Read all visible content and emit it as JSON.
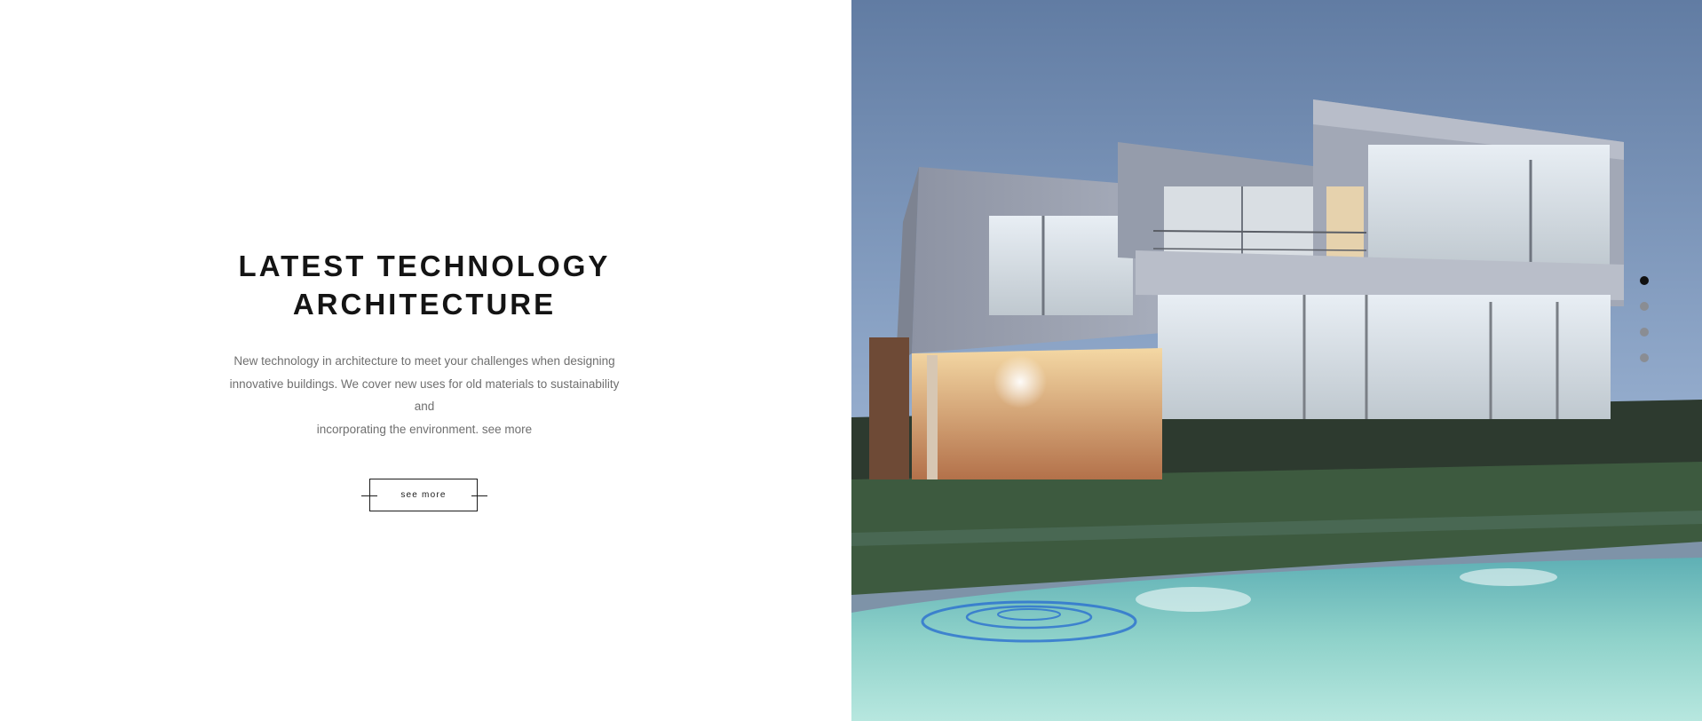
{
  "hero": {
    "headline_line1": "LATEST TECHNOLOGY",
    "headline_line2": "ARCHITECTURE",
    "description_line1": "New technology in architecture to meet your challenges when designing",
    "description_line2": "innovative buildings. We cover new uses for old materials to sustainability and",
    "description_line3": "incorporating the environment. see more",
    "cta_label": "see more"
  },
  "slider": {
    "slide_count": 4,
    "active_index": 0
  },
  "colors": {
    "headline": "#141414",
    "body_text": "#6f6f6f",
    "dot_active": "#111111",
    "dot_inactive": "#8a8d93"
  },
  "icons": {
    "cta_decoration": "horizontal-line-flourish"
  }
}
